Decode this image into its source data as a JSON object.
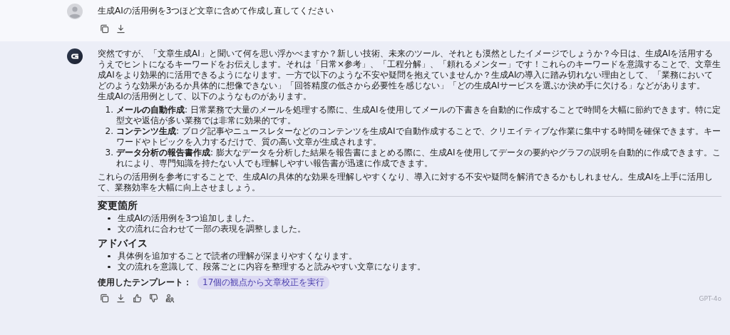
{
  "user_message": {
    "text": "生成AIの活用例を3つほど文章に含めて作成し直してください"
  },
  "assistant_message": {
    "intro": [
      "突然ですが、「文章生成AI」と聞いて何を思い浮かべますか？新しい技術、未来のツール、それとも漠然としたイメージでしょうか？今日は、生成AIを活用するうえでヒントになるキーワードをお伝えします。それは「日常×参考」、「工程分解」、「頼れるメンター」です！これらのキーワードを意識することで、文章生成AIをより効果的に活用できるようになります。一方で以下のような不安や疑問を抱えていませんか？生成AIの導入に踏み切れない理由として、「業務においてどのような効果があるか具体的に想像できない」「回答精度の低さから必要性を感じない」「どの生成AIサービスを選ぶか決め手に欠ける」などがあります。",
      "生成AIの活用例として、以下のようなものがあります。"
    ],
    "examples": [
      {
        "number": "1.",
        "text": "**メールの自動作成**: 日常業務で大量のメールを処理する際に、生成AIを使用してメールの下書きを自動的に作成することで時間を大幅に節約できます。特に定型文や返信が多い業務では非常に効果的です。"
      },
      {
        "number": "2.",
        "text": "**コンテンツ生成**: ブログ記事やニュースレターなどのコンテンツを生成AIで自動作成することで、クリエイティブな作業に集中する時間を確保できます。キーワードやトピックを入力するだけで、質の高い文章が生成されます。"
      },
      {
        "number": "3.",
        "text": "**データ分析の報告書作成**: 膨大なデータを分析した結果を報告書にまとめる際に、生成AIを使用してデータの要約やグラフの説明を自動的に作成できます。これにより、専門知識を持たない人でも理解しやすい報告書が迅速に作成できます。"
      }
    ],
    "closing": "これらの活用例を参考にすることで、生成AIの具体的な効果を理解しやすくなり、導入に対する不安や疑問を解消できるかもしれません。生成AIを上手に活用して、業務効率を大幅に向上させましょう。",
    "sections": [
      {
        "heading": "変更箇所",
        "bullets": [
          "生成AIの活用例を3つ追加しました。",
          "文の流れに合わせて一部の表現を調整しました。"
        ]
      },
      {
        "heading": "アドバイス",
        "bullets": [
          "具体例を追加することで読者の理解が深まりやすくなります。",
          "文の流れを意識して、段落ごとに内容を整理すると読みやすい文章になります。"
        ]
      }
    ],
    "template": {
      "label": "使用したテンプレート：",
      "tag": "17個の観点から文章校正を実行"
    },
    "model": "GPT-4o"
  }
}
